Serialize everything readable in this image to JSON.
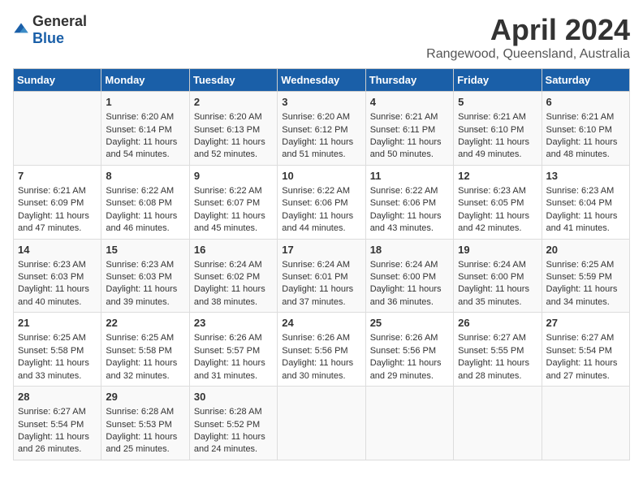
{
  "logo": {
    "general": "General",
    "blue": "Blue"
  },
  "title": "April 2024",
  "location": "Rangewood, Queensland, Australia",
  "days_of_week": [
    "Sunday",
    "Monday",
    "Tuesday",
    "Wednesday",
    "Thursday",
    "Friday",
    "Saturday"
  ],
  "weeks": [
    [
      {
        "day": "",
        "sunrise": "",
        "sunset": "",
        "daylight": ""
      },
      {
        "day": "1",
        "sunrise": "Sunrise: 6:20 AM",
        "sunset": "Sunset: 6:14 PM",
        "daylight": "Daylight: 11 hours and 54 minutes."
      },
      {
        "day": "2",
        "sunrise": "Sunrise: 6:20 AM",
        "sunset": "Sunset: 6:13 PM",
        "daylight": "Daylight: 11 hours and 52 minutes."
      },
      {
        "day": "3",
        "sunrise": "Sunrise: 6:20 AM",
        "sunset": "Sunset: 6:12 PM",
        "daylight": "Daylight: 11 hours and 51 minutes."
      },
      {
        "day": "4",
        "sunrise": "Sunrise: 6:21 AM",
        "sunset": "Sunset: 6:11 PM",
        "daylight": "Daylight: 11 hours and 50 minutes."
      },
      {
        "day": "5",
        "sunrise": "Sunrise: 6:21 AM",
        "sunset": "Sunset: 6:10 PM",
        "daylight": "Daylight: 11 hours and 49 minutes."
      },
      {
        "day": "6",
        "sunrise": "Sunrise: 6:21 AM",
        "sunset": "Sunset: 6:10 PM",
        "daylight": "Daylight: 11 hours and 48 minutes."
      }
    ],
    [
      {
        "day": "7",
        "sunrise": "Sunrise: 6:21 AM",
        "sunset": "Sunset: 6:09 PM",
        "daylight": "Daylight: 11 hours and 47 minutes."
      },
      {
        "day": "8",
        "sunrise": "Sunrise: 6:22 AM",
        "sunset": "Sunset: 6:08 PM",
        "daylight": "Daylight: 11 hours and 46 minutes."
      },
      {
        "day": "9",
        "sunrise": "Sunrise: 6:22 AM",
        "sunset": "Sunset: 6:07 PM",
        "daylight": "Daylight: 11 hours and 45 minutes."
      },
      {
        "day": "10",
        "sunrise": "Sunrise: 6:22 AM",
        "sunset": "Sunset: 6:06 PM",
        "daylight": "Daylight: 11 hours and 44 minutes."
      },
      {
        "day": "11",
        "sunrise": "Sunrise: 6:22 AM",
        "sunset": "Sunset: 6:06 PM",
        "daylight": "Daylight: 11 hours and 43 minutes."
      },
      {
        "day": "12",
        "sunrise": "Sunrise: 6:23 AM",
        "sunset": "Sunset: 6:05 PM",
        "daylight": "Daylight: 11 hours and 42 minutes."
      },
      {
        "day": "13",
        "sunrise": "Sunrise: 6:23 AM",
        "sunset": "Sunset: 6:04 PM",
        "daylight": "Daylight: 11 hours and 41 minutes."
      }
    ],
    [
      {
        "day": "14",
        "sunrise": "Sunrise: 6:23 AM",
        "sunset": "Sunset: 6:03 PM",
        "daylight": "Daylight: 11 hours and 40 minutes."
      },
      {
        "day": "15",
        "sunrise": "Sunrise: 6:23 AM",
        "sunset": "Sunset: 6:03 PM",
        "daylight": "Daylight: 11 hours and 39 minutes."
      },
      {
        "day": "16",
        "sunrise": "Sunrise: 6:24 AM",
        "sunset": "Sunset: 6:02 PM",
        "daylight": "Daylight: 11 hours and 38 minutes."
      },
      {
        "day": "17",
        "sunrise": "Sunrise: 6:24 AM",
        "sunset": "Sunset: 6:01 PM",
        "daylight": "Daylight: 11 hours and 37 minutes."
      },
      {
        "day": "18",
        "sunrise": "Sunrise: 6:24 AM",
        "sunset": "Sunset: 6:00 PM",
        "daylight": "Daylight: 11 hours and 36 minutes."
      },
      {
        "day": "19",
        "sunrise": "Sunrise: 6:24 AM",
        "sunset": "Sunset: 6:00 PM",
        "daylight": "Daylight: 11 hours and 35 minutes."
      },
      {
        "day": "20",
        "sunrise": "Sunrise: 6:25 AM",
        "sunset": "Sunset: 5:59 PM",
        "daylight": "Daylight: 11 hours and 34 minutes."
      }
    ],
    [
      {
        "day": "21",
        "sunrise": "Sunrise: 6:25 AM",
        "sunset": "Sunset: 5:58 PM",
        "daylight": "Daylight: 11 hours and 33 minutes."
      },
      {
        "day": "22",
        "sunrise": "Sunrise: 6:25 AM",
        "sunset": "Sunset: 5:58 PM",
        "daylight": "Daylight: 11 hours and 32 minutes."
      },
      {
        "day": "23",
        "sunrise": "Sunrise: 6:26 AM",
        "sunset": "Sunset: 5:57 PM",
        "daylight": "Daylight: 11 hours and 31 minutes."
      },
      {
        "day": "24",
        "sunrise": "Sunrise: 6:26 AM",
        "sunset": "Sunset: 5:56 PM",
        "daylight": "Daylight: 11 hours and 30 minutes."
      },
      {
        "day": "25",
        "sunrise": "Sunrise: 6:26 AM",
        "sunset": "Sunset: 5:56 PM",
        "daylight": "Daylight: 11 hours and 29 minutes."
      },
      {
        "day": "26",
        "sunrise": "Sunrise: 6:27 AM",
        "sunset": "Sunset: 5:55 PM",
        "daylight": "Daylight: 11 hours and 28 minutes."
      },
      {
        "day": "27",
        "sunrise": "Sunrise: 6:27 AM",
        "sunset": "Sunset: 5:54 PM",
        "daylight": "Daylight: 11 hours and 27 minutes."
      }
    ],
    [
      {
        "day": "28",
        "sunrise": "Sunrise: 6:27 AM",
        "sunset": "Sunset: 5:54 PM",
        "daylight": "Daylight: 11 hours and 26 minutes."
      },
      {
        "day": "29",
        "sunrise": "Sunrise: 6:28 AM",
        "sunset": "Sunset: 5:53 PM",
        "daylight": "Daylight: 11 hours and 25 minutes."
      },
      {
        "day": "30",
        "sunrise": "Sunrise: 6:28 AM",
        "sunset": "Sunset: 5:52 PM",
        "daylight": "Daylight: 11 hours and 24 minutes."
      },
      {
        "day": "",
        "sunrise": "",
        "sunset": "",
        "daylight": ""
      },
      {
        "day": "",
        "sunrise": "",
        "sunset": "",
        "daylight": ""
      },
      {
        "day": "",
        "sunrise": "",
        "sunset": "",
        "daylight": ""
      },
      {
        "day": "",
        "sunrise": "",
        "sunset": "",
        "daylight": ""
      }
    ]
  ]
}
